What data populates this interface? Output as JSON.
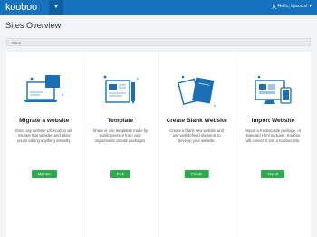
{
  "app": {
    "logo": "kooboo",
    "user_greeting": "Hello, kjaxxxxl"
  },
  "page": {
    "title": "Sites Overview",
    "breadcrumb": "Sites"
  },
  "cards": [
    {
      "title": "Migrate a website",
      "description": "Enter any website Url, kooboo will migrate that website, and allow you to editing anything instantly.",
      "button": "Migrate"
    },
    {
      "title": "Template",
      "description": "Share or use templates made by public users or from your organization private packages.",
      "button": "Pick"
    },
    {
      "title": "Create Blank Website",
      "description": "Create a blank new website and use well defined elements to develop your website.",
      "button": "Create"
    },
    {
      "title": "Import Website",
      "description": "Import a Kooboo site package, or standard Html package, Kooboo will convert it into a Kooboo site.",
      "button": "Import"
    }
  ],
  "colors": {
    "header": "#1672be",
    "button": "#2eab4c",
    "icon_primary": "#1b6fb5",
    "icon_light": "#9cc7ea"
  }
}
